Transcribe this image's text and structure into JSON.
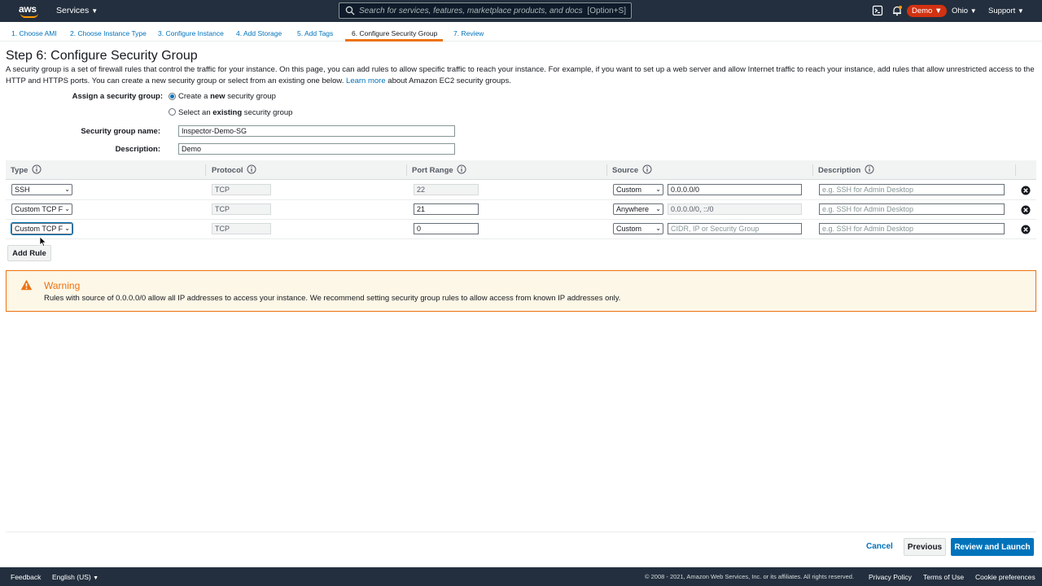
{
  "topnav": {
    "logo": "aws",
    "services_label": "Services",
    "search_placeholder": "Search for services, features, marketplace products, and docs",
    "search_shortcut": "[Option+S]",
    "account_label": "Demo",
    "region_label": "Ohio",
    "support_label": "Support"
  },
  "steps": [
    {
      "label": "1. Choose AMI"
    },
    {
      "label": "2. Choose Instance Type"
    },
    {
      "label": "3. Configure Instance"
    },
    {
      "label": "4. Add Storage"
    },
    {
      "label": "5. Add Tags"
    },
    {
      "label": "6. Configure Security Group"
    },
    {
      "label": "7. Review"
    }
  ],
  "page": {
    "title": "Step 6: Configure Security Group",
    "intro": "A security group is a set of firewall rules that control the traffic for your instance. On this page, you can add rules to allow specific traffic to reach your instance. For example, if you want to set up a web server and allow Internet traffic to reach your instance, add rules that allow unrestricted access to the HTTP and HTTPS ports. You can create a new security group or select from an existing one below.",
    "learn_more": "Learn more",
    "intro_tail": "about Amazon EC2 security groups."
  },
  "assign": {
    "label": "Assign a security group:",
    "option_new_pre": "Create a ",
    "option_new_bold": "new",
    "option_new_post": " security group",
    "option_existing_pre": "Select an ",
    "option_existing_bold": "existing",
    "option_existing_post": " security group",
    "selected": "new"
  },
  "form": {
    "name_label": "Security group name:",
    "name_value": "Inspector-Demo-SG",
    "desc_label": "Description:",
    "desc_value": "Demo"
  },
  "table": {
    "headers": {
      "type": "Type",
      "protocol": "Protocol",
      "port_range": "Port Range",
      "source": "Source",
      "description": "Description"
    },
    "rows": [
      {
        "type": "SSH",
        "protocol": "TCP",
        "port": "22",
        "source_mode": "Custom",
        "source_value": "0.0.0.0/0",
        "description_placeholder": "e.g. SSH for Admin Desktop"
      },
      {
        "type": "Custom TCP F",
        "protocol": "TCP",
        "port": "21",
        "source_mode": "Anywhere",
        "source_value": "0.0.0.0/0, ::/0",
        "description_placeholder": "e.g. SSH for Admin Desktop"
      },
      {
        "type": "Custom TCP F",
        "protocol": "TCP",
        "port": "0",
        "source_mode": "Custom",
        "source_placeholder": "CIDR, IP or Security Group",
        "description_placeholder": "e.g. SSH for Admin Desktop"
      }
    ],
    "add_rule_label": "Add Rule"
  },
  "warning": {
    "title": "Warning",
    "text": "Rules with source of 0.0.0.0/0 allow all IP addresses to access your instance. We recommend setting security group rules to allow access from known IP addresses only."
  },
  "actions": {
    "cancel": "Cancel",
    "previous": "Previous",
    "review_launch": "Review and Launch"
  },
  "footer": {
    "feedback": "Feedback",
    "language": "English (US)",
    "copyright": "© 2008 - 2021, Amazon Web Services, Inc. or its affiliates. All rights reserved.",
    "privacy": "Privacy Policy",
    "terms": "Terms of Use",
    "cookies": "Cookie preferences"
  },
  "colors": {
    "nav_bg": "#232f3e",
    "link": "#0073bb",
    "accent_orange": "#ec7211",
    "account_badge": "#d13212"
  }
}
